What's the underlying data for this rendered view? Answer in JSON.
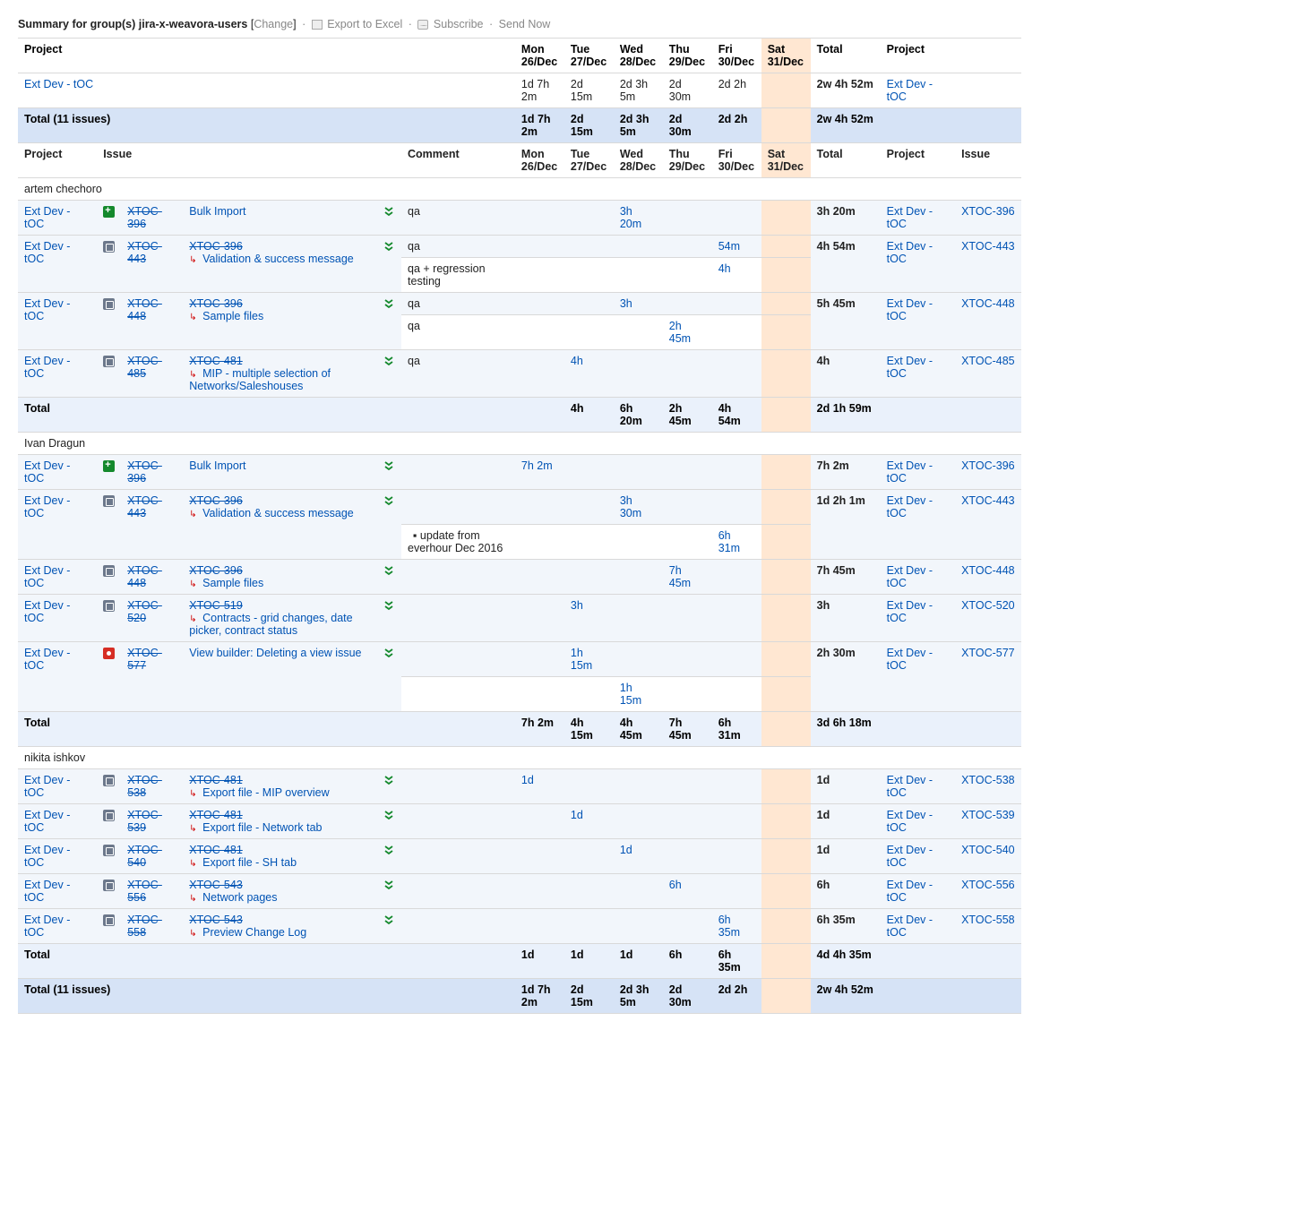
{
  "header": {
    "prefix": "Summary for group(s)",
    "group": "jira-x-weavora-users",
    "change": "Change",
    "export": "Export to Excel",
    "subscribe": "Subscribe",
    "send_now": "Send Now"
  },
  "columns": {
    "project": "Project",
    "issue": "Issue",
    "comment": "Comment",
    "days": [
      {
        "top": "Mon",
        "bot": "26/Dec"
      },
      {
        "top": "Tue",
        "bot": "27/Dec"
      },
      {
        "top": "Wed",
        "bot": "28/Dec"
      },
      {
        "top": "Thu",
        "bot": "29/Dec"
      },
      {
        "top": "Fri",
        "bot": "30/Dec"
      },
      {
        "top": "Sat",
        "bot": "31/Dec"
      }
    ],
    "total": "Total"
  },
  "project_row": {
    "name": "Ext Dev - tOC",
    "day_vals": [
      "1d 7h 2m",
      "2d 15m",
      "2d 3h 5m",
      "2d 30m",
      "2d 2h",
      ""
    ],
    "total": "2w 4h 52m"
  },
  "grand": {
    "label": "Total (11 issues)",
    "day_vals": [
      "1d 7h 2m",
      "2d 15m",
      "2d 3h 5m",
      "2d 30m",
      "2d 2h",
      ""
    ],
    "total": "2w 4h 52m"
  },
  "total_label": "Total",
  "groups": [
    {
      "user": "artem chechoro",
      "rows": [
        {
          "proj": "Ext Dev - tOC",
          "icon": "story",
          "key": "XTOC-396",
          "key_strike": true,
          "title": "Bulk Import",
          "title_strike": false,
          "parent": null,
          "key2": "XTOC-396",
          "comment_rows": [
            {
              "comment": "qa",
              "days": [
                "",
                "",
                "3h 20m",
                "",
                "",
                ""
              ]
            }
          ],
          "total": "3h 20m"
        },
        {
          "proj": "Ext Dev - tOC",
          "icon": "sub",
          "key": "XTOC-443",
          "key_strike": true,
          "title": "Validation & success message",
          "title_strike": false,
          "parent": "XTOC-396",
          "key2": "XTOC-443",
          "comment_rows": [
            {
              "comment": "qa",
              "days": [
                "",
                "",
                "",
                "",
                "54m",
                ""
              ]
            },
            {
              "comment": "qa + regression testing",
              "days": [
                "",
                "",
                "",
                "",
                "4h",
                ""
              ]
            }
          ],
          "total": "4h 54m"
        },
        {
          "proj": "Ext Dev - tOC",
          "icon": "sub",
          "key": "XTOC-448",
          "key_strike": true,
          "title": "Sample files",
          "title_strike": false,
          "parent": "XTOC-396",
          "key2": "XTOC-448",
          "comment_rows": [
            {
              "comment": "qa",
              "days": [
                "",
                "",
                "3h",
                "",
                "",
                ""
              ]
            },
            {
              "comment": "qa",
              "days": [
                "",
                "",
                "",
                "2h 45m",
                "",
                ""
              ]
            }
          ],
          "total": "5h 45m"
        },
        {
          "proj": "Ext Dev - tOC",
          "icon": "sub",
          "key": "XTOC-485",
          "key_strike": true,
          "title": "MIP - multiple selection of Networks/Saleshouses",
          "title_strike": false,
          "parent": "XTOC-481",
          "key2": "XTOC-485",
          "comment_rows": [
            {
              "comment": "qa",
              "days": [
                "",
                "4h",
                "",
                "",
                "",
                ""
              ]
            }
          ],
          "total": "4h"
        }
      ],
      "subtotal": {
        "days": [
          "",
          "4h",
          "6h 20m",
          "2h 45m",
          "4h 54m",
          ""
        ],
        "total": "2d 1h 59m"
      }
    },
    {
      "user": "Ivan Dragun",
      "rows": [
        {
          "proj": "Ext Dev - tOC",
          "icon": "story",
          "key": "XTOC-396",
          "key_strike": true,
          "title": "Bulk Import",
          "title_strike": false,
          "parent": null,
          "key2": "XTOC-396",
          "comment_rows": [
            {
              "comment": "",
              "days": [
                "7h 2m",
                "",
                "",
                "",
                "",
                ""
              ]
            }
          ],
          "total": "7h 2m"
        },
        {
          "proj": "Ext Dev - tOC",
          "icon": "sub",
          "key": "XTOC-443",
          "key_strike": true,
          "title": "Validation & success message",
          "title_strike": false,
          "parent": "XTOC-396",
          "key2": "XTOC-443",
          "comment_rows": [
            {
              "comment": "",
              "days": [
                "",
                "",
                "3h 30m",
                "",
                "",
                ""
              ]
            },
            {
              "comment": "update from everhour Dec 2016",
              "bullet": true,
              "days": [
                "",
                "",
                "",
                "",
                "6h 31m",
                ""
              ]
            }
          ],
          "total": "1d 2h 1m"
        },
        {
          "proj": "Ext Dev - tOC",
          "icon": "sub",
          "key": "XTOC-448",
          "key_strike": true,
          "title": "Sample files",
          "title_strike": false,
          "parent": "XTOC-396",
          "key2": "XTOC-448",
          "comment_rows": [
            {
              "comment": "",
              "days": [
                "",
                "",
                "",
                "7h 45m",
                "",
                ""
              ]
            }
          ],
          "total": "7h 45m"
        },
        {
          "proj": "Ext Dev - tOC",
          "icon": "sub",
          "key": "XTOC-520",
          "key_strike": true,
          "title": "Contracts - grid changes, date picker, contract status",
          "title_strike": false,
          "parent": "XTOC-519",
          "key2": "XTOC-520",
          "comment_rows": [
            {
              "comment": "",
              "days": [
                "",
                "3h",
                "",
                "",
                "",
                ""
              ]
            }
          ],
          "total": "3h"
        },
        {
          "proj": "Ext Dev - tOC",
          "icon": "bug",
          "key": "XTOC-577",
          "key_strike": true,
          "title": "View builder: Deleting a view issue",
          "title_strike": false,
          "parent": null,
          "key2": "XTOC-577",
          "comment_rows": [
            {
              "comment": "",
              "days": [
                "",
                "1h 15m",
                "",
                "",
                "",
                ""
              ]
            },
            {
              "comment": "",
              "days": [
                "",
                "",
                "1h 15m",
                "",
                "",
                ""
              ]
            }
          ],
          "total": "2h 30m"
        }
      ],
      "subtotal": {
        "days": [
          "7h 2m",
          "4h 15m",
          "4h 45m",
          "7h 45m",
          "6h 31m",
          ""
        ],
        "total": "3d 6h 18m"
      }
    },
    {
      "user": "nikita ishkov",
      "rows": [
        {
          "proj": "Ext Dev - tOC",
          "icon": "sub",
          "key": "XTOC-538",
          "key_strike": true,
          "title": "Export file - MIP overview",
          "title_strike": false,
          "parent": "XTOC-481",
          "key2": "XTOC-538",
          "comment_rows": [
            {
              "comment": "",
              "days": [
                "1d",
                "",
                "",
                "",
                "",
                ""
              ]
            }
          ],
          "total": "1d"
        },
        {
          "proj": "Ext Dev - tOC",
          "icon": "sub",
          "key": "XTOC-539",
          "key_strike": true,
          "title": "Export file - Network tab",
          "title_strike": false,
          "parent": "XTOC-481",
          "key2": "XTOC-539",
          "comment_rows": [
            {
              "comment": "",
              "days": [
                "",
                "1d",
                "",
                "",
                "",
                ""
              ]
            }
          ],
          "total": "1d"
        },
        {
          "proj": "Ext Dev - tOC",
          "icon": "sub",
          "key": "XTOC-540",
          "key_strike": true,
          "title": "Export file - SH tab",
          "title_strike": false,
          "parent": "XTOC-481",
          "key2": "XTOC-540",
          "comment_rows": [
            {
              "comment": "",
              "days": [
                "",
                "",
                "1d",
                "",
                "",
                ""
              ]
            }
          ],
          "total": "1d"
        },
        {
          "proj": "Ext Dev - tOC",
          "icon": "sub",
          "key": "XTOC-556",
          "key_strike": true,
          "title": "Network pages",
          "title_strike": false,
          "parent": "XTOC-543",
          "key2": "XTOC-556",
          "comment_rows": [
            {
              "comment": "",
              "days": [
                "",
                "",
                "",
                "6h",
                "",
                ""
              ]
            }
          ],
          "total": "6h"
        },
        {
          "proj": "Ext Dev - tOC",
          "icon": "sub",
          "key": "XTOC-558",
          "key_strike": true,
          "title": "Preview Change Log",
          "title_strike": false,
          "parent": "XTOC-543",
          "key2": "XTOC-558",
          "comment_rows": [
            {
              "comment": "",
              "days": [
                "",
                "",
                "",
                "",
                "6h 35m",
                ""
              ]
            }
          ],
          "total": "6h 35m"
        }
      ],
      "subtotal": {
        "days": [
          "1d",
          "1d",
          "1d",
          "6h",
          "6h 35m",
          ""
        ],
        "total": "4d 4h 35m"
      }
    }
  ]
}
